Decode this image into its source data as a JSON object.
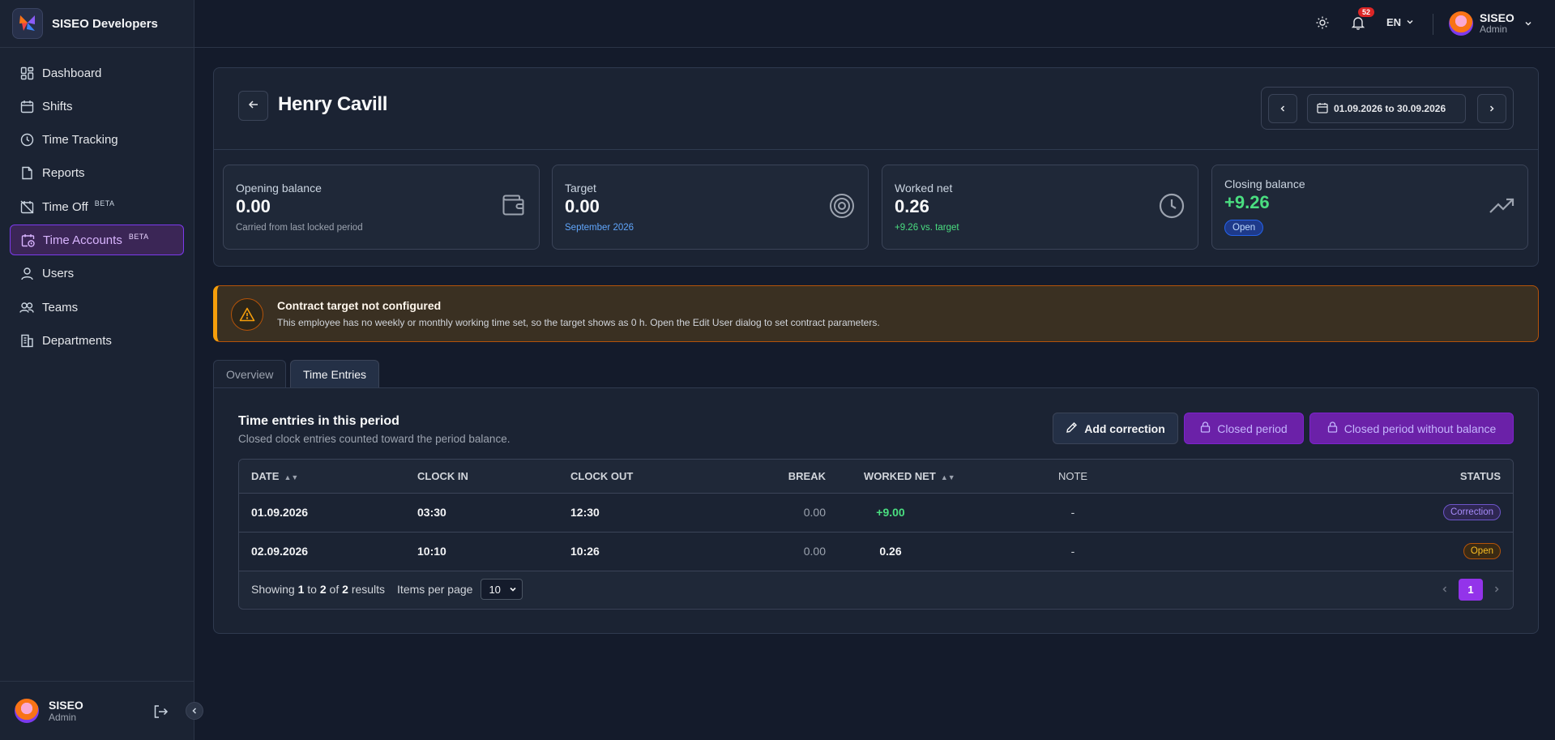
{
  "brand": {
    "name": "SISEO Developers"
  },
  "sidebar": {
    "items": [
      {
        "label": "Dashboard",
        "icon": "dashboard-icon"
      },
      {
        "label": "Shifts",
        "icon": "calendar-icon"
      },
      {
        "label": "Time Tracking",
        "icon": "clock-icon"
      },
      {
        "label": "Reports",
        "icon": "document-icon"
      },
      {
        "label": "Time Off",
        "icon": "calendar-off-icon",
        "badge": "BETA"
      },
      {
        "label": "Time Accounts",
        "icon": "calendar-clock-icon",
        "badge": "BETA",
        "active": true
      },
      {
        "label": "Users",
        "icon": "user-icon"
      },
      {
        "label": "Teams",
        "icon": "users-icon"
      },
      {
        "label": "Departments",
        "icon": "building-icon"
      }
    ],
    "user": {
      "name": "SISEO",
      "role": "Admin"
    }
  },
  "topbar": {
    "notification_count": "52",
    "language": "EN",
    "user": {
      "name": "SISEO",
      "role": "Admin"
    }
  },
  "header": {
    "employee_name": "Henry Cavill",
    "date_range": "01.09.2026 to 30.09.2026"
  },
  "stats": {
    "opening": {
      "label": "Opening balance",
      "value": "0.00",
      "sub": "Carried from last locked period"
    },
    "target": {
      "label": "Target",
      "value": "0.00",
      "sub": "September 2026"
    },
    "worked": {
      "label": "Worked net",
      "value": "0.26",
      "sub": "+9.26 vs. target"
    },
    "closing": {
      "label": "Closing balance",
      "value": "+9.26",
      "badge": "Open"
    }
  },
  "alert": {
    "title": "Contract target not configured",
    "text": "This employee has no weekly or monthly working time set, so the target shows as 0 h. Open the Edit User dialog to set contract parameters."
  },
  "tabs": [
    {
      "label": "Overview"
    },
    {
      "label": "Time Entries",
      "active": true
    }
  ],
  "entries": {
    "title": "Time entries in this period",
    "subtitle": "Closed clock entries counted toward the period balance.",
    "buttons": {
      "add_correction": "Add correction",
      "closed_period": "Closed period",
      "closed_period_no_balance": "Closed period without balance"
    },
    "columns": {
      "date": "DATE",
      "clock_in": "CLOCK IN",
      "clock_out": "CLOCK OUT",
      "break": "BREAK",
      "worked_net": "WORKED NET",
      "note": "NOTE",
      "status": "STATUS"
    },
    "rows": [
      {
        "date": "01.09.2026",
        "clock_in": "03:30",
        "clock_out": "12:30",
        "break": "0.00",
        "worked_net": "+9.00",
        "note": "-",
        "status": "Correction"
      },
      {
        "date": "02.09.2026",
        "clock_in": "10:10",
        "clock_out": "10:26",
        "break": "0.00",
        "worked_net": "0.26",
        "note": "-",
        "status": "Open"
      }
    ],
    "footer": {
      "showing": "Showing",
      "from": "1",
      "to_word": "to",
      "to": "2",
      "of_word": "of",
      "total": "2",
      "results": "results",
      "items_per_page_label": "Items per page",
      "items_per_page": "10",
      "current_page": "1"
    }
  },
  "colors": {
    "accent": "#9333ea",
    "positive": "#4ade80",
    "warning": "#f59e0b",
    "background": "#141b2b",
    "panel": "#1b2333"
  }
}
